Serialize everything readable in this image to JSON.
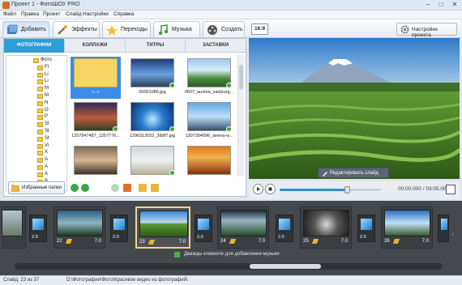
{
  "window": {
    "title": "Проект 1 - ФотоШОУ PRO",
    "minimize": "–",
    "maximize": "□",
    "close": "✕"
  },
  "menu": [
    "Файл",
    "Правка",
    "Проект",
    "Слайд",
    "Настройки",
    "Справка"
  ],
  "toolbar": {
    "tabs": [
      {
        "label": "Добавить",
        "icon": "add-photos-icon"
      },
      {
        "label": "Эффекты",
        "icon": "effects-icon"
      },
      {
        "label": "Переходы",
        "icon": "transitions-icon"
      },
      {
        "label": "Музыка",
        "icon": "music-icon"
      },
      {
        "label": "Создать",
        "icon": "film-reel-icon"
      }
    ],
    "aspect_ratio": "16:9",
    "project_settings": "Настройки проекта"
  },
  "left_panel": {
    "subtabs": [
      "ФОТОГРАФИИ",
      "КОЛЛАЖИ",
      "ТИТРЫ",
      "ЗАСТАВКИ"
    ],
    "tree": [
      "Фото",
      "Fl",
      "Li",
      "Li",
      "M",
      "M",
      "N",
      "O",
      "P",
      "Sl",
      "St",
      "St",
      "Vi",
      "X",
      "А",
      "А",
      "А",
      "В",
      "Д"
    ],
    "thumbs": [
      {
        "caption": "<..>"
      },
      {
        "caption": "00001086.jpg"
      },
      {
        "caption": "0607_austria_salzburg..."
      },
      {
        "caption": "1257847487_1257776..."
      },
      {
        "caption": "1296312052_38df7.jpg"
      },
      {
        "caption": "1307394996_airena-w..."
      },
      {
        "caption": ""
      },
      {
        "caption": ""
      },
      {
        "caption": ""
      }
    ],
    "favorites": "Избранные папки"
  },
  "preview": {
    "edit_slide": "Редактировать слайд"
  },
  "player": {
    "time": "00:00.000 / 03:05.000",
    "progress": 0.66
  },
  "timeline": {
    "slides": [
      {
        "num": "22",
        "dur": "7.0"
      },
      {
        "num": "23",
        "dur": "7.0"
      },
      {
        "num": "24",
        "dur": "7.0"
      },
      {
        "num": "25",
        "dur": "7.0"
      },
      {
        "num": "26",
        "dur": "7.0"
      }
    ],
    "transitions": [
      "2.0",
      "2.0",
      "2.0",
      "2.0",
      "2.0",
      "2.0"
    ],
    "music_hint": "Дважды кликните для добавления музыки"
  },
  "status": {
    "slide": "Слайд: 23 из 37",
    "path": "D:\\Фотографии\\Фото\\Красивое видео из фотографий\\"
  }
}
